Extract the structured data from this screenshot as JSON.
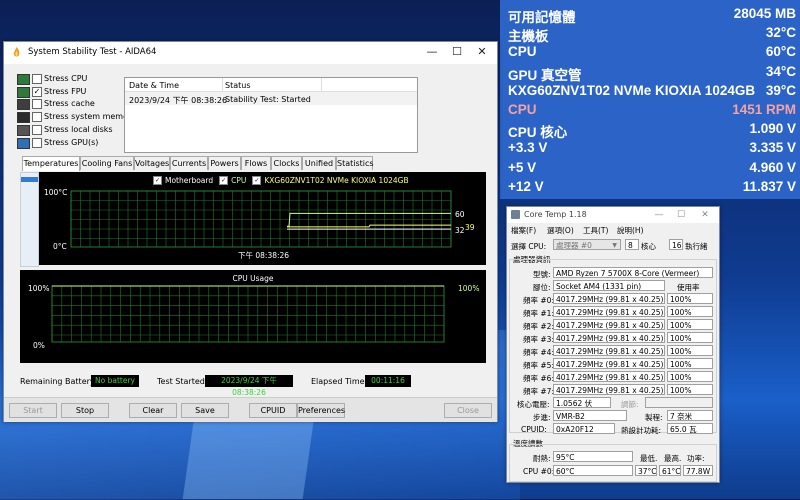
{
  "sensors": [
    {
      "label": "可用記憶體",
      "value": "28045 MB",
      "color": "#ffffff"
    },
    {
      "label": "主機板",
      "value": "32°C",
      "color": "#ffffff"
    },
    {
      "label": "CPU",
      "value": "60°C",
      "color": "#ffffff"
    },
    {
      "label": "GPU 真空管",
      "value": "34°C",
      "color": "#ffffff"
    },
    {
      "label": "KXG60ZNV1T02 NVMe KIOXIA 1024GB",
      "value": "39°C",
      "color": "#ffffff"
    },
    {
      "label": "CPU",
      "value": "1451 RPM",
      "color": "#f4a3a3"
    },
    {
      "label": "CPU 核心",
      "value": "1.090 V",
      "color": "#ffffff"
    },
    {
      "label": "+3.3 V",
      "value": "3.335 V",
      "color": "#ffffff"
    },
    {
      "label": "+5 V",
      "value": "4.960 V",
      "color": "#ffffff"
    },
    {
      "label": "+12 V",
      "value": "11.837 V",
      "color": "#ffffff"
    }
  ],
  "aida": {
    "title": "System Stability Test - AIDA64",
    "stress": [
      {
        "label": "Stress CPU",
        "checked": false
      },
      {
        "label": "Stress FPU",
        "checked": true
      },
      {
        "label": "Stress cache",
        "checked": false
      },
      {
        "label": "Stress system memory",
        "checked": false
      },
      {
        "label": "Stress local disks",
        "checked": false
      },
      {
        "label": "Stress GPU(s)",
        "checked": false
      }
    ],
    "log_headers": [
      "Date & Time",
      "Status"
    ],
    "log_rows": [
      {
        "time": "2023/9/24 下午 08:38:26",
        "status": "Stability Test: Started"
      }
    ],
    "tabs": [
      "Temperatures",
      "Cooling Fans",
      "Voltages",
      "Currents",
      "Powers",
      "Flows",
      "Clocks",
      "Unified",
      "Statistics"
    ],
    "temp_graph": {
      "legend": [
        "Motherboard",
        "CPU",
        "KXG60ZNV1T02 NVMe KIOXIA 1024GB"
      ],
      "legend_colors": [
        "#ffffff",
        "#c8ff8c",
        "#ffff64"
      ],
      "y_top": "100°C",
      "y_bottom": "0°C",
      "x_label": "下午 08:38:26",
      "values": [
        "60",
        "32",
        "39"
      ]
    },
    "usage_graph": {
      "title": "CPU Usage",
      "y_top": "100%",
      "y_bottom": "0%",
      "right_value": "100%"
    },
    "battery_label": "Remaining Battery:",
    "battery_value": "No battery",
    "started_label": "Test Started:",
    "started_value": "2023/9/24 下午 08:38:26",
    "elapsed_label": "Elapsed Time:",
    "elapsed_value": "00:11:16",
    "buttons": {
      "start": "Start",
      "stop": "Stop",
      "clear": "Clear",
      "save": "Save",
      "cpuid": "CPUID",
      "prefs": "Preferences",
      "close": "Close"
    }
  },
  "coretemp": {
    "title": "Core Temp 1.18",
    "menu": [
      "檔案(F)",
      "選項(O)",
      "工具(T)",
      "說明(H)"
    ],
    "select_label": "選擇 CPU:",
    "select_value": "處理器 #0",
    "cores": "8",
    "cores_label": "核心",
    "threads": "16",
    "threads_label": "執行緒",
    "info_title": "處理器資訊",
    "model_label": "型號:",
    "model_value": "AMD Ryzen 7 5700X 8-Core (Vermeer)",
    "socket_label": "腳位:",
    "socket_value": "Socket AM4 (1331 pin)",
    "usage_hdr": "使用率",
    "freq": [
      {
        "label": "頻率 #0:",
        "value": "4017.29MHz (99.81 x 40.25)",
        "usage": "100%"
      },
      {
        "label": "頻率 #1:",
        "value": "4017.29MHz (99.81 x 40.25)",
        "usage": "100%"
      },
      {
        "label": "頻率 #2:",
        "value": "4017.29MHz (99.81 x 40.25)",
        "usage": "100%"
      },
      {
        "label": "頻率 #3:",
        "value": "4017.29MHz (99.81 x 40.25)",
        "usage": "100%"
      },
      {
        "label": "頻率 #4:",
        "value": "4017.29MHz (99.81 x 40.25)",
        "usage": "100%"
      },
      {
        "label": "頻率 #5:",
        "value": "4017.29MHz (99.81 x 40.25)",
        "usage": "100%"
      },
      {
        "label": "頻率 #6:",
        "value": "4017.29MHz (99.81 x 40.25)",
        "usage": "100%"
      },
      {
        "label": "頻率 #7:",
        "value": "4017.29MHz (99.81 x 40.25)",
        "usage": "100%"
      }
    ],
    "vid_label": "核心電壓:",
    "vid_value": "1.0562 伏",
    "rev_label": "調節:",
    "step_label": "步進:",
    "step_value": "VMR-B2",
    "lith_label": "製程:",
    "lith_value": "7 奈米",
    "cpuid_label": "CPUID:",
    "cpuid_value": "0xA20F12",
    "tdp_label": "熱設計功耗:",
    "tdp_value": "65.0 瓦",
    "temp_title": "溫度讀數",
    "tj_label": "耐熱:",
    "tj_value": "95°C",
    "min_label": "最低.",
    "max_label": "最高.",
    "power_label": "功率:",
    "cpu0_label": "CPU #0:",
    "cpu0_value": "60°C",
    "cpu0_min": "37°C",
    "cpu0_max": "61°C",
    "cpu0_power": "77.8W"
  }
}
